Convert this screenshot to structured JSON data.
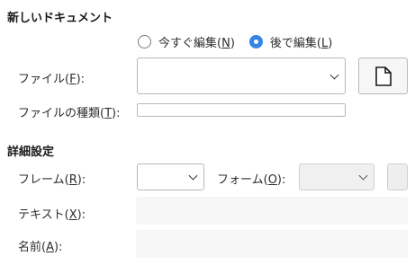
{
  "new_document": {
    "heading": "新しいドキュメント",
    "radio_edit_now": {
      "label_pre": "今すぐ編集(",
      "mnemonic": "N",
      "label_post": ")",
      "checked": false
    },
    "radio_edit_later": {
      "label_pre": "後で編集(",
      "mnemonic": "L",
      "label_post": ")",
      "checked": true
    },
    "file_label_pre": "ファイル(",
    "file_mnemonic": "F",
    "file_label_post": "):",
    "file_value": "",
    "new_file_icon": "document-icon",
    "file_type_label_pre": "ファイルの種類(",
    "file_type_mnemonic": "T",
    "file_type_label_post": "):",
    "file_type_value": ""
  },
  "advanced": {
    "heading": "詳細設定",
    "frame_label_pre": "フレーム(",
    "frame_mnemonic": "R",
    "frame_label_post": "):",
    "frame_value": "",
    "form_label_pre": "フォーム(",
    "form_mnemonic": "O",
    "form_label_post": "):",
    "form_value": "",
    "text_label_pre": "テキスト(",
    "text_mnemonic": "X",
    "text_label_post": "):",
    "text_value": "",
    "name_label_pre": "名前(",
    "name_mnemonic": "A",
    "name_label_post": "):",
    "name_value": ""
  },
  "colors": {
    "accent": "#3584e4",
    "border": "#b8b8b8",
    "disabled_bg": "#f6f6f6"
  }
}
